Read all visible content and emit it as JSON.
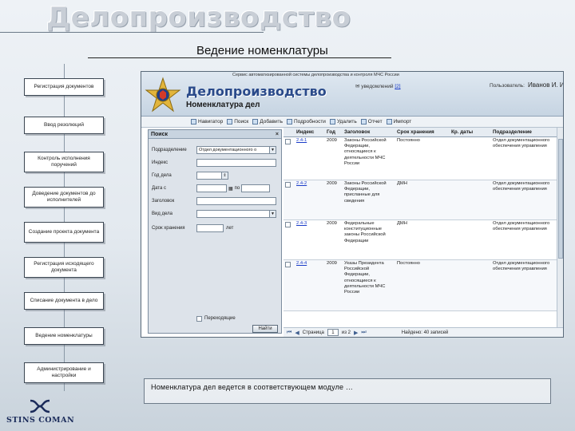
{
  "slide": {
    "title": "Делопроизводство",
    "subtitle": "Ведение номенклатуры",
    "caption": "Номенклатура дел ведется в соответствующем модуле …"
  },
  "flow": [
    "Регистрация документов",
    "Ввод резолюций",
    "Контроль исполнения поручений",
    "Доведение документов до исполнителей",
    "Создание проекта документа",
    "Регистрация исходящего документа",
    "Списание документа в дело",
    "Ведение номенклатуры",
    "Администрирование и настройки"
  ],
  "logo": {
    "text": "STINS COMAN"
  },
  "app": {
    "system_title": "Сервис автоматизированной системы делопроизводства и контроля МЧС России",
    "title": "Делопроизводство",
    "notifications_label": "уведомлений",
    "notifications_count": "[2]",
    "user_label": "Пользователь:",
    "user_name": "Иванов И. И.",
    "module_title": "Номенклатура дел",
    "toolbar": [
      "Навигатор",
      "Поиск",
      "Добавить",
      "Подробности",
      "Удалить",
      "Отчет",
      "Импорт"
    ],
    "grid": {
      "columns": [
        "",
        "Индекс",
        "Год",
        "Заголовок",
        "Срок хранения",
        "Кр. даты",
        "Подразделение"
      ],
      "rows": [
        {
          "index": "2.4-1",
          "year": "2009",
          "title": "Законы Российской Федерации, относящиеся к деятельности МЧС России",
          "term": "Постоянно",
          "dates": "",
          "dept": "Отдел документационного обеспечения управления"
        },
        {
          "index": "2.4-2",
          "year": "2009",
          "title": "Законы Российской Федерации, присланные для сведения",
          "term": "ДМН",
          "dates": "",
          "dept": "Отдел документационного обеспечения управления"
        },
        {
          "index": "2.4-3",
          "year": "2009",
          "title": "Федеральные конституционные законы Российской Федерации",
          "term": "ДМН",
          "dates": "",
          "dept": "Отдел документационного обеспечения управления"
        },
        {
          "index": "2.4-4",
          "year": "2009",
          "title": "Указы Президента Российской Федерации, относящиеся к деятельности МЧС России",
          "term": "Постоянно",
          "dates": "",
          "dept": "Отдел документационного обеспечения управления"
        }
      ]
    },
    "pager": {
      "label": "Страница",
      "page": "1",
      "of": "из 2",
      "found": "Найдено: 40 записей"
    },
    "search": {
      "title": "Поиск",
      "close": "×",
      "fields": [
        {
          "label": "Подразделение",
          "value": "Отдел документационного о",
          "type": "select"
        },
        {
          "label": "Индекс",
          "value": "",
          "type": "input"
        },
        {
          "label": "Год дела",
          "value": "",
          "type": "spin"
        },
        {
          "label": "Дата с",
          "value": "",
          "type": "daterange",
          "to_label": "по"
        },
        {
          "label": "Заголовок",
          "value": "",
          "type": "input"
        },
        {
          "label": "Вид дела",
          "value": "",
          "type": "select"
        },
        {
          "label": "Срок хранения",
          "value": "",
          "type": "term",
          "unit": "лет"
        }
      ],
      "checkbox_label": "Переходящие",
      "button": "Найти"
    }
  }
}
